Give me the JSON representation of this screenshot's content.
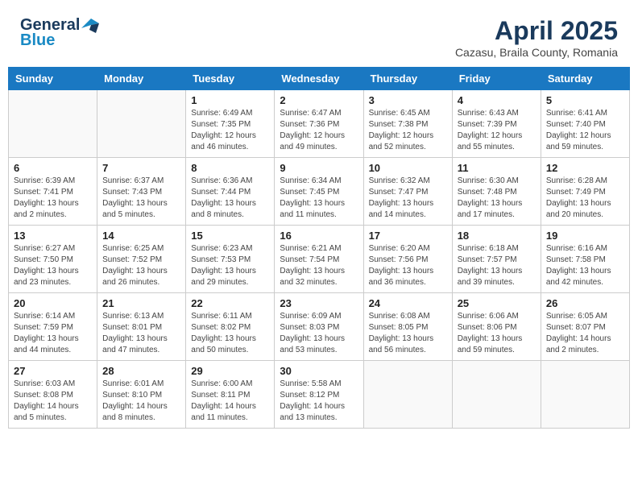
{
  "logo": {
    "general": "General",
    "blue": "Blue"
  },
  "title": "April 2025",
  "subtitle": "Cazasu, Braila County, Romania",
  "days_header": [
    "Sunday",
    "Monday",
    "Tuesday",
    "Wednesday",
    "Thursday",
    "Friday",
    "Saturday"
  ],
  "weeks": [
    [
      {
        "day": "",
        "info": ""
      },
      {
        "day": "",
        "info": ""
      },
      {
        "day": "1",
        "info": "Sunrise: 6:49 AM\nSunset: 7:35 PM\nDaylight: 12 hours and 46 minutes."
      },
      {
        "day": "2",
        "info": "Sunrise: 6:47 AM\nSunset: 7:36 PM\nDaylight: 12 hours and 49 minutes."
      },
      {
        "day": "3",
        "info": "Sunrise: 6:45 AM\nSunset: 7:38 PM\nDaylight: 12 hours and 52 minutes."
      },
      {
        "day": "4",
        "info": "Sunrise: 6:43 AM\nSunset: 7:39 PM\nDaylight: 12 hours and 55 minutes."
      },
      {
        "day": "5",
        "info": "Sunrise: 6:41 AM\nSunset: 7:40 PM\nDaylight: 12 hours and 59 minutes."
      }
    ],
    [
      {
        "day": "6",
        "info": "Sunrise: 6:39 AM\nSunset: 7:41 PM\nDaylight: 13 hours and 2 minutes."
      },
      {
        "day": "7",
        "info": "Sunrise: 6:37 AM\nSunset: 7:43 PM\nDaylight: 13 hours and 5 minutes."
      },
      {
        "day": "8",
        "info": "Sunrise: 6:36 AM\nSunset: 7:44 PM\nDaylight: 13 hours and 8 minutes."
      },
      {
        "day": "9",
        "info": "Sunrise: 6:34 AM\nSunset: 7:45 PM\nDaylight: 13 hours and 11 minutes."
      },
      {
        "day": "10",
        "info": "Sunrise: 6:32 AM\nSunset: 7:47 PM\nDaylight: 13 hours and 14 minutes."
      },
      {
        "day": "11",
        "info": "Sunrise: 6:30 AM\nSunset: 7:48 PM\nDaylight: 13 hours and 17 minutes."
      },
      {
        "day": "12",
        "info": "Sunrise: 6:28 AM\nSunset: 7:49 PM\nDaylight: 13 hours and 20 minutes."
      }
    ],
    [
      {
        "day": "13",
        "info": "Sunrise: 6:27 AM\nSunset: 7:50 PM\nDaylight: 13 hours and 23 minutes."
      },
      {
        "day": "14",
        "info": "Sunrise: 6:25 AM\nSunset: 7:52 PM\nDaylight: 13 hours and 26 minutes."
      },
      {
        "day": "15",
        "info": "Sunrise: 6:23 AM\nSunset: 7:53 PM\nDaylight: 13 hours and 29 minutes."
      },
      {
        "day": "16",
        "info": "Sunrise: 6:21 AM\nSunset: 7:54 PM\nDaylight: 13 hours and 32 minutes."
      },
      {
        "day": "17",
        "info": "Sunrise: 6:20 AM\nSunset: 7:56 PM\nDaylight: 13 hours and 36 minutes."
      },
      {
        "day": "18",
        "info": "Sunrise: 6:18 AM\nSunset: 7:57 PM\nDaylight: 13 hours and 39 minutes."
      },
      {
        "day": "19",
        "info": "Sunrise: 6:16 AM\nSunset: 7:58 PM\nDaylight: 13 hours and 42 minutes."
      }
    ],
    [
      {
        "day": "20",
        "info": "Sunrise: 6:14 AM\nSunset: 7:59 PM\nDaylight: 13 hours and 44 minutes."
      },
      {
        "day": "21",
        "info": "Sunrise: 6:13 AM\nSunset: 8:01 PM\nDaylight: 13 hours and 47 minutes."
      },
      {
        "day": "22",
        "info": "Sunrise: 6:11 AM\nSunset: 8:02 PM\nDaylight: 13 hours and 50 minutes."
      },
      {
        "day": "23",
        "info": "Sunrise: 6:09 AM\nSunset: 8:03 PM\nDaylight: 13 hours and 53 minutes."
      },
      {
        "day": "24",
        "info": "Sunrise: 6:08 AM\nSunset: 8:05 PM\nDaylight: 13 hours and 56 minutes."
      },
      {
        "day": "25",
        "info": "Sunrise: 6:06 AM\nSunset: 8:06 PM\nDaylight: 13 hours and 59 minutes."
      },
      {
        "day": "26",
        "info": "Sunrise: 6:05 AM\nSunset: 8:07 PM\nDaylight: 14 hours and 2 minutes."
      }
    ],
    [
      {
        "day": "27",
        "info": "Sunrise: 6:03 AM\nSunset: 8:08 PM\nDaylight: 14 hours and 5 minutes."
      },
      {
        "day": "28",
        "info": "Sunrise: 6:01 AM\nSunset: 8:10 PM\nDaylight: 14 hours and 8 minutes."
      },
      {
        "day": "29",
        "info": "Sunrise: 6:00 AM\nSunset: 8:11 PM\nDaylight: 14 hours and 11 minutes."
      },
      {
        "day": "30",
        "info": "Sunrise: 5:58 AM\nSunset: 8:12 PM\nDaylight: 14 hours and 13 minutes."
      },
      {
        "day": "",
        "info": ""
      },
      {
        "day": "",
        "info": ""
      },
      {
        "day": "",
        "info": ""
      }
    ]
  ]
}
